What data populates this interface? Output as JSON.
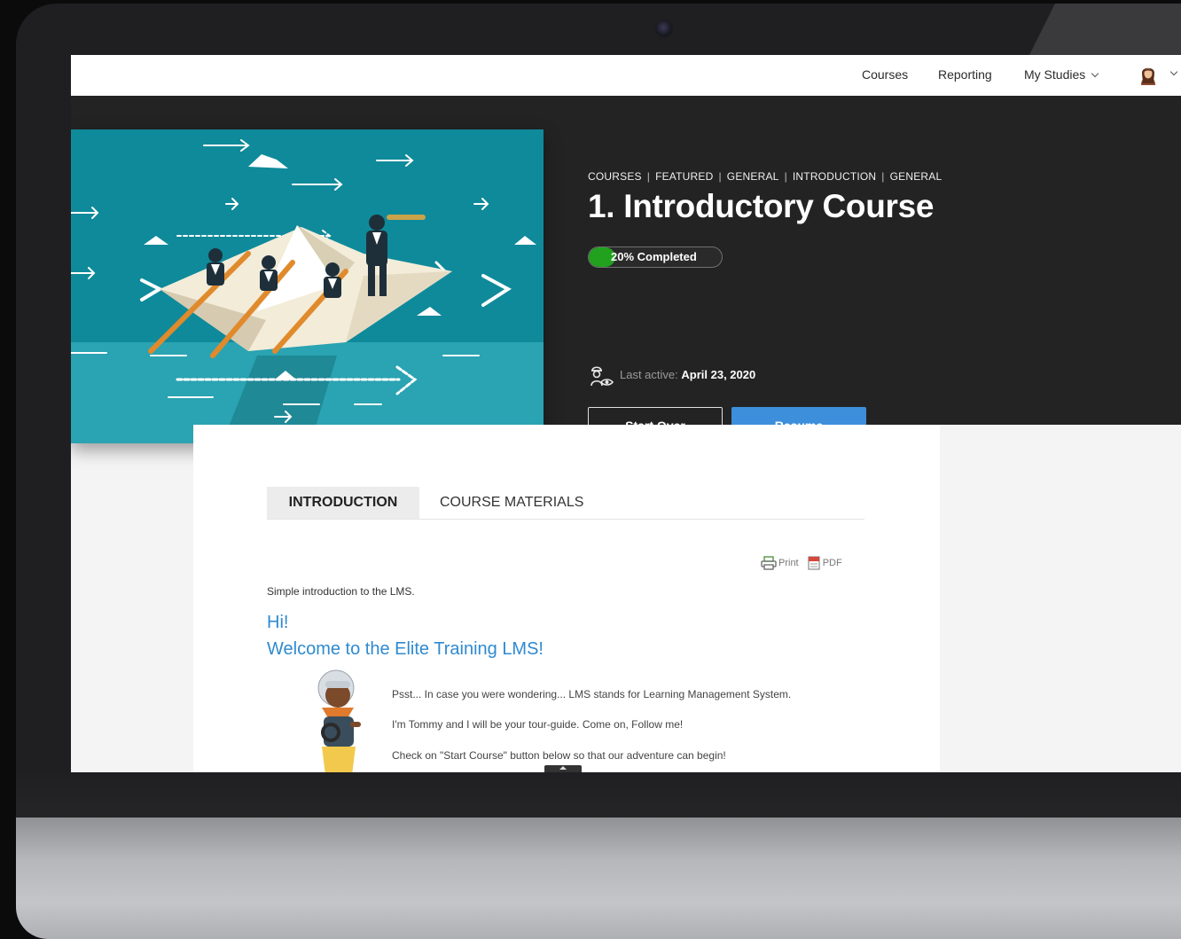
{
  "nav": {
    "courses": "Courses",
    "reporting": "Reporting",
    "my_studies": "My Studies"
  },
  "breadcrumb": [
    "COURSES",
    "FEATURED",
    "GENERAL",
    "INTRODUCTION",
    "GENERAL"
  ],
  "course": {
    "title": "1. Introductory Course",
    "progress_percent": 20,
    "progress_label": "20% Completed",
    "last_active_label": "Last active:",
    "last_active_date": "April 23, 2020"
  },
  "actions": {
    "start_over": "Start Over",
    "resume": "Resume"
  },
  "tabs": {
    "introduction": "INTRODUCTION",
    "course_materials": "COURSE MATERIALS"
  },
  "tools": {
    "print": "Print",
    "pdf": "PDF"
  },
  "content": {
    "intro": "Simple introduction to the LMS.",
    "hi": "Hi!",
    "welcome": "Welcome to the Elite Training LMS!",
    "para1": "Psst... In case you were wondering... LMS stands for Learning Management System.",
    "para2": "I'm Tommy and I will be your tour-guide. Come on, Follow me!",
    "para3": "Check on \"Start Course\" button below so that our adventure can begin!"
  },
  "colors": {
    "accent_blue": "#3d8fdc",
    "heading_blue": "#2f8ad0",
    "progress_green": "#22a11f",
    "hero_bg": "#232323"
  },
  "icons": {
    "user_avatar": "avatar-icon",
    "last_active": "pilot-eye-icon",
    "print": "printer-icon",
    "pdf": "pdf-icon"
  }
}
